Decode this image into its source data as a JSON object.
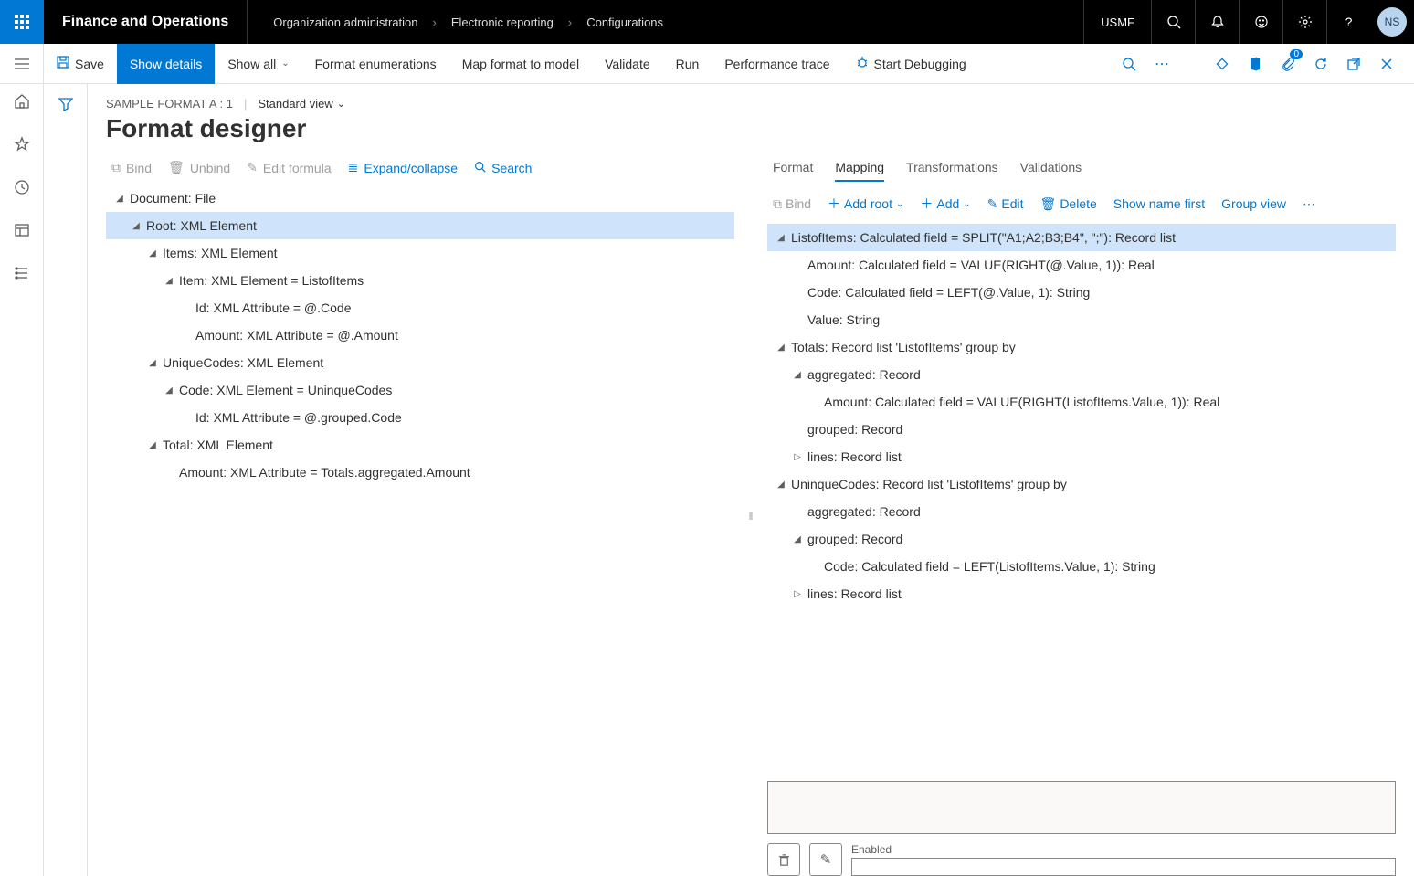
{
  "topbar": {
    "app_title": "Finance and Operations",
    "breadcrumb": [
      "Organization administration",
      "Electronic reporting",
      "Configurations"
    ],
    "company": "USMF",
    "avatar": "NS"
  },
  "actionbar": {
    "save": "Save",
    "show_details": "Show details",
    "show_all": "Show all",
    "format_enum": "Format enumerations",
    "map_format": "Map format to model",
    "validate": "Validate",
    "run": "Run",
    "perf_trace": "Performance trace",
    "start_debug": "Start Debugging",
    "badge": "0"
  },
  "header": {
    "context": "SAMPLE FORMAT A : 1",
    "view": "Standard view",
    "title": "Format designer"
  },
  "left_toolbar": {
    "bind": "Bind",
    "unbind": "Unbind",
    "edit_formula": "Edit formula",
    "expand": "Expand/collapse",
    "search": "Search"
  },
  "left_tree": [
    {
      "indent": 0,
      "arrow": "▾",
      "text": "Document: File",
      "sel": false
    },
    {
      "indent": 1,
      "arrow": "▾",
      "text": "Root: XML Element",
      "sel": true
    },
    {
      "indent": 2,
      "arrow": "▾",
      "text": "Items: XML Element",
      "sel": false
    },
    {
      "indent": 3,
      "arrow": "▾",
      "text": "Item: XML Element = ListofItems",
      "sel": false
    },
    {
      "indent": 4,
      "arrow": "",
      "text": "Id: XML Attribute = @.Code",
      "sel": false
    },
    {
      "indent": 4,
      "arrow": "",
      "text": "Amount: XML Attribute = @.Amount",
      "sel": false
    },
    {
      "indent": 2,
      "arrow": "▾",
      "text": "UniqueCodes: XML Element",
      "sel": false
    },
    {
      "indent": 3,
      "arrow": "▾",
      "text": "Code: XML Element = UninqueCodes",
      "sel": false
    },
    {
      "indent": 4,
      "arrow": "",
      "text": "Id: XML Attribute = @.grouped.Code",
      "sel": false
    },
    {
      "indent": 2,
      "arrow": "▾",
      "text": "Total: XML Element",
      "sel": false
    },
    {
      "indent": 3,
      "arrow": "",
      "text": "Amount: XML Attribute = Totals.aggregated.Amount",
      "sel": false
    }
  ],
  "tabs": {
    "format": "Format",
    "mapping": "Mapping",
    "transformations": "Transformations",
    "validations": "Validations"
  },
  "right_toolbar": {
    "bind": "Bind",
    "add_root": "Add root",
    "add": "Add",
    "edit": "Edit",
    "delete": "Delete",
    "show_name": "Show name first",
    "group_view": "Group view"
  },
  "right_tree": [
    {
      "indent": 0,
      "arrow": "▾",
      "text": "ListofItems: Calculated field = SPLIT(\"A1;A2;B3;B4\", \";\"): Record list",
      "sel": true
    },
    {
      "indent": 1,
      "arrow": "",
      "text": "Amount: Calculated field = VALUE(RIGHT(@.Value, 1)): Real",
      "sel": false
    },
    {
      "indent": 1,
      "arrow": "",
      "text": "Code: Calculated field = LEFT(@.Value, 1): String",
      "sel": false
    },
    {
      "indent": 1,
      "arrow": "",
      "text": "Value: String",
      "sel": false
    },
    {
      "indent": 0,
      "arrow": "▾",
      "text": "Totals: Record list 'ListofItems' group by",
      "sel": false
    },
    {
      "indent": 1,
      "arrow": "▾",
      "text": "aggregated: Record",
      "sel": false
    },
    {
      "indent": 2,
      "arrow": "",
      "text": "Amount: Calculated field = VALUE(RIGHT(ListofItems.Value, 1)): Real",
      "sel": false
    },
    {
      "indent": 1,
      "arrow": "",
      "text": "grouped: Record",
      "sel": false
    },
    {
      "indent": 1,
      "arrow": "▸",
      "text": "lines: Record list",
      "sel": false
    },
    {
      "indent": 0,
      "arrow": "▾",
      "text": "UninqueCodes: Record list 'ListofItems' group by",
      "sel": false
    },
    {
      "indent": 1,
      "arrow": "",
      "text": "aggregated: Record",
      "sel": false
    },
    {
      "indent": 1,
      "arrow": "▾",
      "text": "grouped: Record",
      "sel": false
    },
    {
      "indent": 2,
      "arrow": "",
      "text": "Code: Calculated field = LEFT(ListofItems.Value, 1): String",
      "sel": false
    },
    {
      "indent": 1,
      "arrow": "▸",
      "text": "lines: Record list",
      "sel": false
    }
  ],
  "bottom": {
    "enabled_label": "Enabled"
  }
}
